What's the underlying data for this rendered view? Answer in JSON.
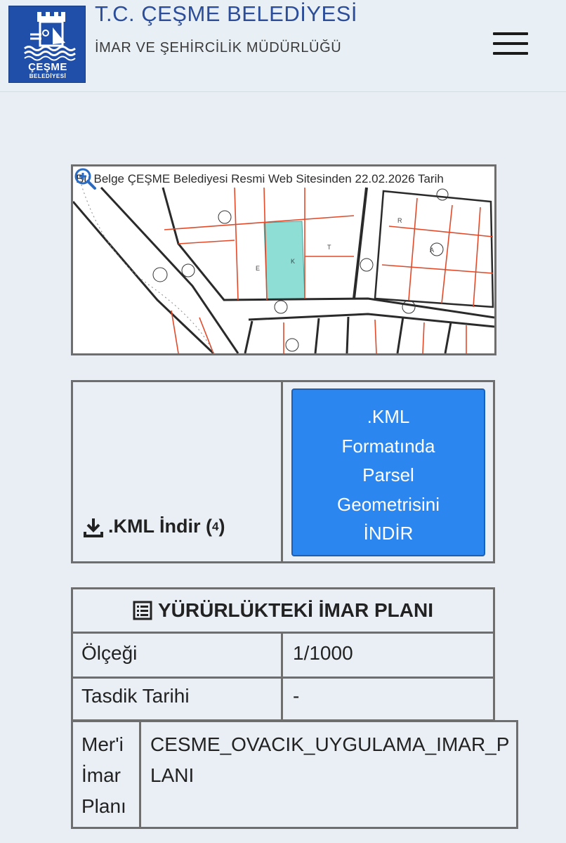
{
  "header": {
    "logo_line1": "ÇEŞME",
    "logo_line2": "BELEDİYESİ",
    "title": "T.C. ÇEŞME BELEDİYESİ",
    "subtitle": "İMAR VE ŞEHİRCİLİK MÜDÜRLÜĞÜ",
    "menu_icon": "hamburger-icon",
    "brand_color": "#1f4fa8"
  },
  "map": {
    "banner": "Bu Belge ÇEŞME Belediyesi Resmi Web Sitesinden 22.02.2026 Tarih",
    "zoom_icon": "zoom-in-icon",
    "highlight_color": "#8fded6"
  },
  "kml": {
    "download_label": ".KML İndir (",
    "download_count": "4",
    "download_close": ")",
    "button_lines": [
      ".KML",
      "Formatında",
      "Parsel",
      "Geometrisini",
      "İNDİR"
    ],
    "button_color": "#2c86f0"
  },
  "plan": {
    "title": "YÜRÜRLÜKTEKİ İMAR PLANI",
    "rows": [
      {
        "label": "Ölçeği",
        "value": "1/1000"
      },
      {
        "label": "Tasdik Tarihi",
        "value": "-"
      }
    ],
    "plan_label": "Mer'i İmar Planı",
    "plan_value": "CESME_OVACIK_UYGULAMA_IMAR_PLANI"
  }
}
